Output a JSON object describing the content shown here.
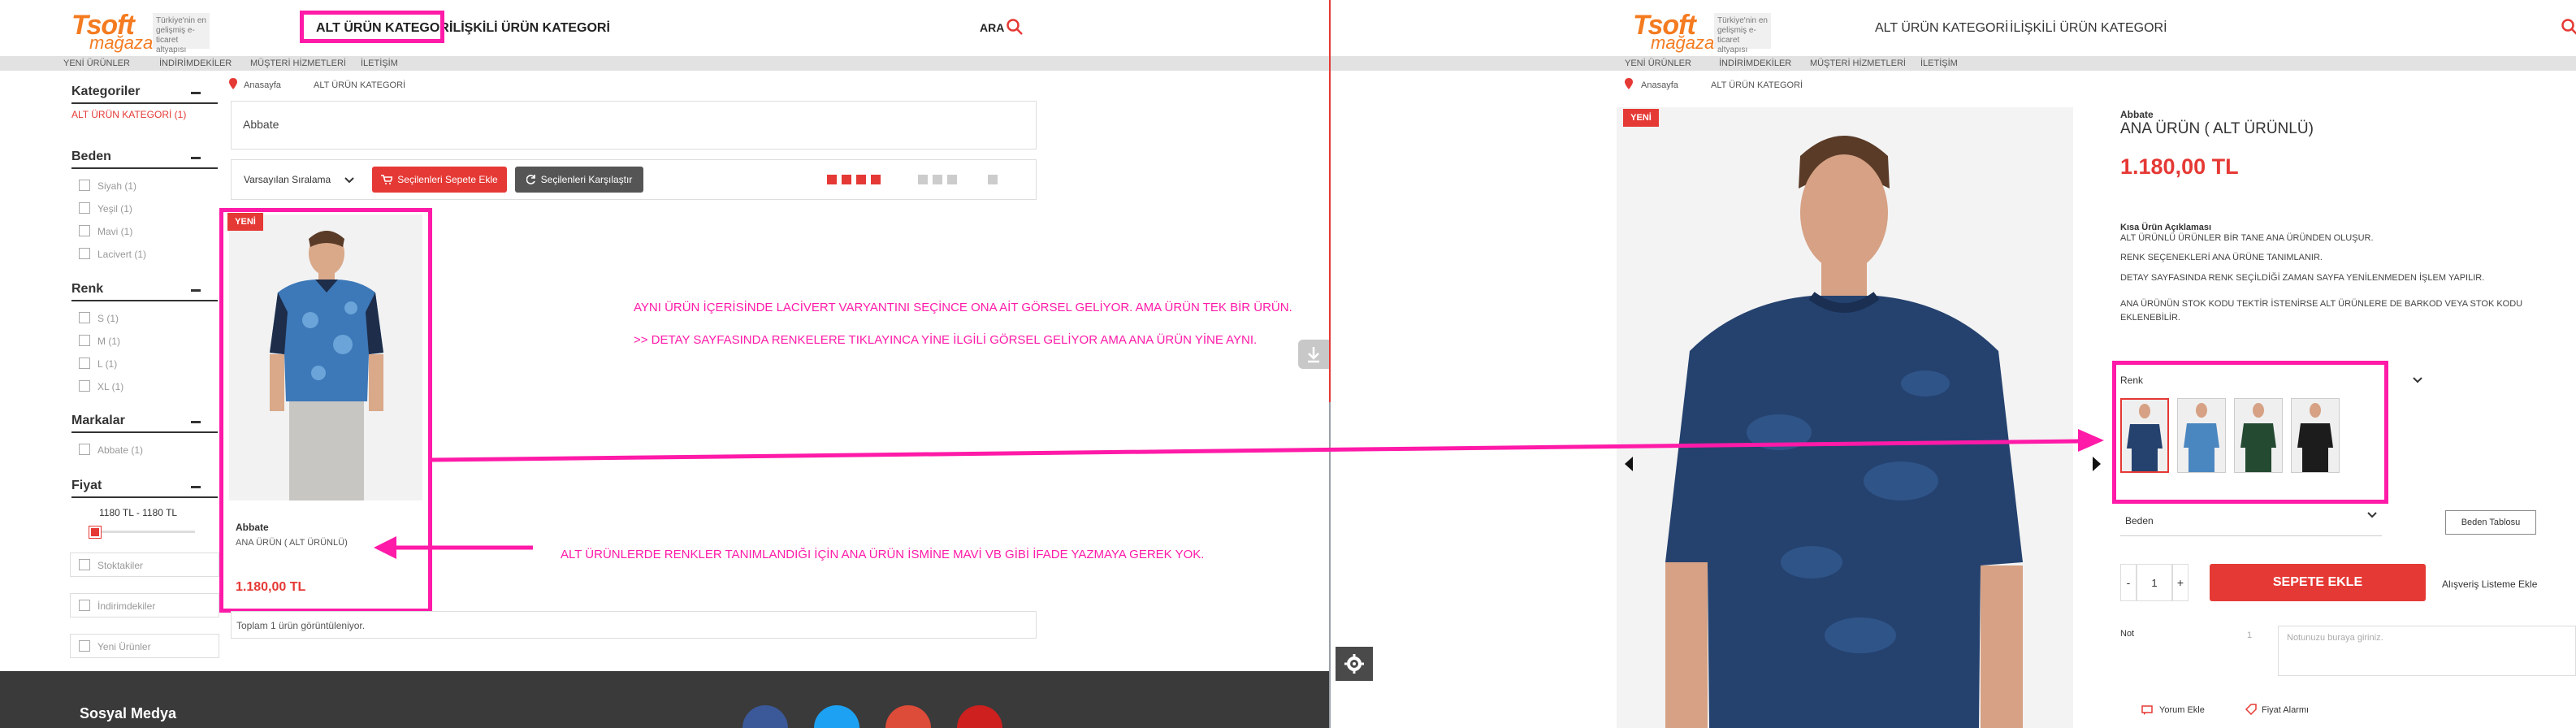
{
  "left": {
    "logo": {
      "brand": "Tsoft",
      "sub": "mağaza",
      "tagline": "Türkiye'nin en gelişmiş e-ticaret altyapısı"
    },
    "nav": {
      "alt_urun": "ALT ÜRÜN KATEGORİ",
      "iliskili": "İLİŞKİLİ ÜRÜN KATEGORİ",
      "ara": "ARA"
    },
    "subnav": [
      "YENİ ÜRÜNLER",
      "İNDİRİMDEKİLER",
      "MÜŞTERİ HİZMETLERİ",
      "İLETİŞİM"
    ],
    "breadcrumb": {
      "home": "Anasayfa",
      "current": "ALT ÜRÜN KATEGORİ"
    },
    "sidebar": {
      "kategoriler": {
        "title": "Kategoriler",
        "item": "ALT ÜRÜN KATEGORİ (1)"
      },
      "beden": {
        "title": "Beden",
        "items": [
          "Siyah (1)",
          "Yeşil (1)",
          "Mavi (1)",
          "Lacivert (1)"
        ]
      },
      "renk": {
        "title": "Renk",
        "items": [
          "S (1)",
          "M (1)",
          "L (1)",
          "XL (1)"
        ]
      },
      "markalar": {
        "title": "Markalar",
        "items": [
          "Abbate (1)"
        ]
      },
      "fiyat": {
        "title": "Fiyat",
        "range": "1180 TL - 1180 TL"
      },
      "extra": [
        "Stoktakiler",
        "İndirimdekiler",
        "Yeni Ürünler"
      ]
    },
    "listing": {
      "brand_box": "Abbate",
      "sort": "Varsayılan Sıralama",
      "add_cart": "Seçilenleri Sepete Ekle",
      "compare": "Seçilenleri Karşılaştır",
      "product": {
        "badge": "YENİ",
        "brand": "Abbate",
        "name": "ANA ÜRÜN ( ALT ÜRÜNLÜ)",
        "price": "1.180,00 TL"
      },
      "total": "Toplam 1 ürün görüntüleniyor."
    },
    "notes": {
      "n1": "AYNI ÜRÜN İÇERİSİNDE  LACİVERT VARYANTINI SEÇİNCE ONA AİT GÖRSEL GELİYOR. AMA ÜRÜN TEK BİR ÜRÜN.",
      "n2": ">> DETAY SAYFASINDA RENKELERE TIKLAYINCA YİNE İLGİLİ GÖRSEL GELİYOR AMA ANA ÜRÜN YİNE AYNI.",
      "n3": "ALT ÜRÜNLERDE RENKLER TANIMLANDIĞI İÇİN ANA ÜRÜN İSMİNE MAVİ VB GİBİ İFADE YAZMAYA GEREK YOK."
    },
    "footer": {
      "title": "Sosyal Medya"
    }
  },
  "right": {
    "nav": {
      "alt_urun": "ALT ÜRÜN KATEGORİ",
      "iliskili": "İLİŞKİLİ ÜRÜN KATEGORİ"
    },
    "subnav": [
      "YENİ ÜRÜNLER",
      "İNDİRİMDEKİLER",
      "MÜŞTERİ HİZMETLERİ",
      "İLETİŞİM"
    ],
    "breadcrumb": {
      "home": "Anasayfa",
      "current": "ALT ÜRÜN KATEGORİ"
    },
    "badge": "YENİ",
    "brand": "Abbate",
    "title": "ANA ÜRÜN ( ALT ÜRÜNLÜ)",
    "price": "1.180,00 TL",
    "desc_title": "Kısa Ürün Açıklaması",
    "desc": [
      "ALT ÜRÜNLÜ ÜRÜNLER BİR TANE ANA ÜRÜNDEN OLUŞUR.",
      "RENK SEÇENEKLERİ ANA ÜRÜNE TANIMLANIR.",
      "DETAY SAYFASINDA RENK SEÇİLDİĞİ ZAMAN SAYFA YENİLENMEDEN İŞLEM YAPILIR.",
      "ANA ÜRÜNÜN STOK KODU TEKTİR İSTENİRSE ALT ÜRÜNLERE DE BARKOD VEYA STOK KODU EKLENEBİLİR."
    ],
    "renk_label": "Renk",
    "beden_label": "Beden",
    "beden_tablosu": "Beden Tablosu",
    "qty_minus": "-",
    "qty": "1",
    "qty_plus": "+",
    "add_to_cart": "SEPETE EKLE",
    "wishlist": "Alışveriş Listeme Ekle",
    "note_label": "Not",
    "note_placeholder": "Notunuzu buraya giriniz.",
    "yorum": "Yorum Ekle",
    "fiyat_alarmi": "Fiyat Alarmı"
  },
  "colors": {
    "accent": "#e53935",
    "brand": "#f47b20",
    "annotation": "#ff1aa8",
    "footer": "#3a3a3a"
  }
}
